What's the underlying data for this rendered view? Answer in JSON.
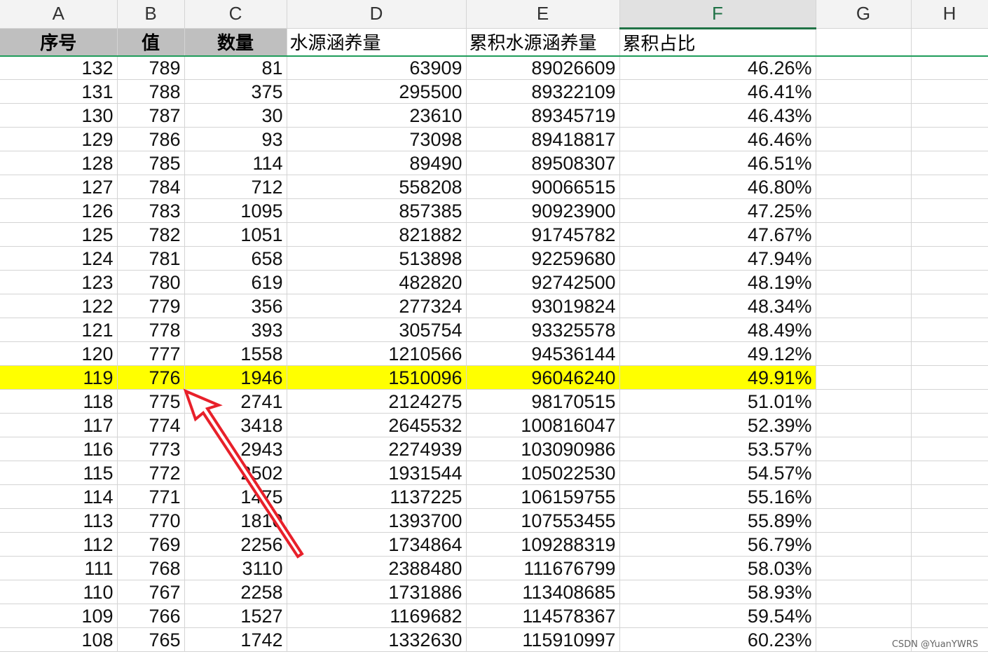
{
  "columns": [
    "A",
    "B",
    "C",
    "D",
    "E",
    "F",
    "G",
    "H"
  ],
  "active_column": "F",
  "headers": {
    "a": "序号",
    "b": "值",
    "c": "数量",
    "d": "水源涵养量",
    "e": "累积水源涵养量",
    "f": "累积占比"
  },
  "rows": [
    [
      "132",
      "789",
      "81",
      "63909",
      "89026609",
      "46.26%"
    ],
    [
      "131",
      "788",
      "375",
      "295500",
      "89322109",
      "46.41%"
    ],
    [
      "130",
      "787",
      "30",
      "23610",
      "89345719",
      "46.43%"
    ],
    [
      "129",
      "786",
      "93",
      "73098",
      "89418817",
      "46.46%"
    ],
    [
      "128",
      "785",
      "114",
      "89490",
      "89508307",
      "46.51%"
    ],
    [
      "127",
      "784",
      "712",
      "558208",
      "90066515",
      "46.80%"
    ],
    [
      "126",
      "783",
      "1095",
      "857385",
      "90923900",
      "47.25%"
    ],
    [
      "125",
      "782",
      "1051",
      "821882",
      "91745782",
      "47.67%"
    ],
    [
      "124",
      "781",
      "658",
      "513898",
      "92259680",
      "47.94%"
    ],
    [
      "123",
      "780",
      "619",
      "482820",
      "92742500",
      "48.19%"
    ],
    [
      "122",
      "779",
      "356",
      "277324",
      "93019824",
      "48.34%"
    ],
    [
      "121",
      "778",
      "393",
      "305754",
      "93325578",
      "48.49%"
    ],
    [
      "120",
      "777",
      "1558",
      "1210566",
      "94536144",
      "49.12%"
    ],
    [
      "119",
      "776",
      "1946",
      "1510096",
      "96046240",
      "49.91%"
    ],
    [
      "118",
      "775",
      "2741",
      "2124275",
      "98170515",
      "51.01%"
    ],
    [
      "117",
      "774",
      "3418",
      "2645532",
      "100816047",
      "52.39%"
    ],
    [
      "116",
      "773",
      "2943",
      "2274939",
      "103090986",
      "53.57%"
    ],
    [
      "115",
      "772",
      "2502",
      "1931544",
      "105022530",
      "54.57%"
    ],
    [
      "114",
      "771",
      "1475",
      "1137225",
      "106159755",
      "55.16%"
    ],
    [
      "113",
      "770",
      "1810",
      "1393700",
      "107553455",
      "55.89%"
    ],
    [
      "112",
      "769",
      "2256",
      "1734864",
      "109288319",
      "56.79%"
    ],
    [
      "111",
      "768",
      "3110",
      "2388480",
      "111676799",
      "58.03%"
    ],
    [
      "110",
      "767",
      "2258",
      "1731886",
      "113408685",
      "58.93%"
    ],
    [
      "109",
      "766",
      "1527",
      "1169682",
      "114578367",
      "59.54%"
    ],
    [
      "108",
      "765",
      "1742",
      "1332630",
      "115910997",
      "60.23%"
    ]
  ],
  "highlight_row_index": 13,
  "highlight_color": "#ffff00",
  "arrow_color": "#e8202a",
  "watermark": "CSDN @YuanYWRS"
}
